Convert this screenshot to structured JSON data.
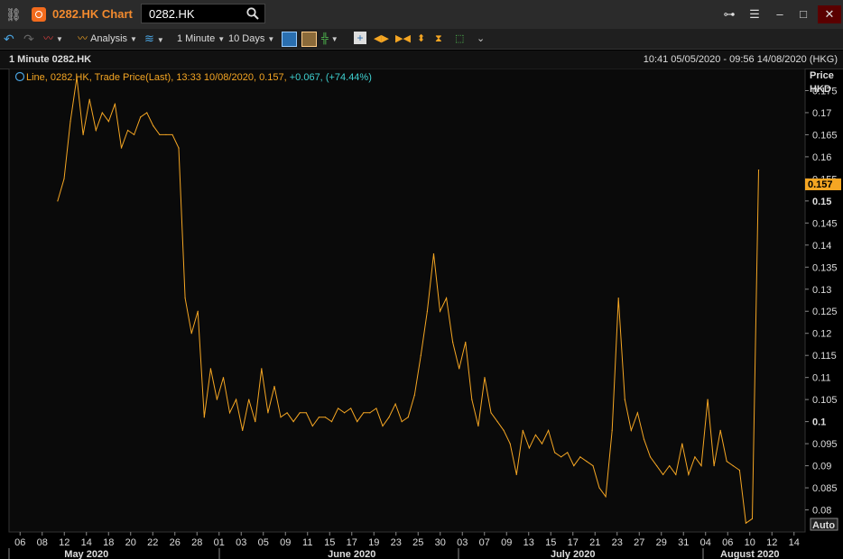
{
  "window": {
    "title": "0282.HK Chart",
    "ticker_value": "0282.HK",
    "colors": {
      "accent": "#f28a2e",
      "series": "#f5a623",
      "positive": "#3fd0d0",
      "current_label_bg": "#f5a623"
    }
  },
  "toolbar": {
    "analysis_label": "Analysis",
    "interval_label": "1 Minute",
    "period_label": "10 Days"
  },
  "chart_header": {
    "name": "1 Minute 0282.HK",
    "range": "10:41 05/05/2020 - 09:56 14/08/2020 (HKG)"
  },
  "legend": {
    "prefix": "Line, 0282.HK, Trade Price(Last),",
    "time": "13:33 10/08/2020,",
    "price": "0.157,",
    "change": "+0.067,",
    "change_pct": "(+74.44%)"
  },
  "axis": {
    "y_title_1": "Price",
    "y_title_2": "HKD",
    "auto_label": "Auto",
    "current_value_label": "0.157"
  },
  "chart_data": {
    "type": "line",
    "title": "1 Minute 0282.HK",
    "series": [
      {
        "name": "Line, 0282.HK, Trade Price(Last)",
        "color": "#f5a623"
      }
    ],
    "ylabel": "Price HKD",
    "ylim": [
      0.075,
      0.18
    ],
    "yticks": [
      "0.175",
      "0.17",
      "0.165",
      "0.16",
      "0.155",
      "0.15",
      "0.145",
      "0.14",
      "0.135",
      "0.13",
      "0.125",
      "0.12",
      "0.115",
      "0.11",
      "0.105",
      "0.1",
      "0.095",
      "0.09",
      "0.085",
      "0.08"
    ],
    "x_tick_labels": [
      "06",
      "08",
      "12",
      "14",
      "18",
      "20",
      "22",
      "26",
      "28",
      "01",
      "03",
      "05",
      "09",
      "11",
      "15",
      "17",
      "19",
      "23",
      "25",
      "30",
      "03",
      "07",
      "09",
      "13",
      "15",
      "17",
      "21",
      "23",
      "27",
      "29",
      "31",
      "04",
      "06",
      "10",
      "12",
      "14"
    ],
    "x_months": [
      "May 2020",
      "June 2020",
      "July 2020",
      "August 2020"
    ],
    "points": [
      [
        "2020-05-11",
        0.15
      ],
      [
        "2020-05-11",
        0.155
      ],
      [
        "2020-05-12",
        0.168
      ],
      [
        "2020-05-12",
        0.178
      ],
      [
        "2020-05-12",
        0.165
      ],
      [
        "2020-05-13",
        0.173
      ],
      [
        "2020-05-13",
        0.166
      ],
      [
        "2020-05-14",
        0.17
      ],
      [
        "2020-05-15",
        0.168
      ],
      [
        "2020-05-15",
        0.172
      ],
      [
        "2020-05-18",
        0.162
      ],
      [
        "2020-05-18",
        0.166
      ],
      [
        "2020-05-19",
        0.165
      ],
      [
        "2020-05-19",
        0.169
      ],
      [
        "2020-05-20",
        0.17
      ],
      [
        "2020-05-20",
        0.167
      ],
      [
        "2020-05-21",
        0.165
      ],
      [
        "2020-05-22",
        0.165
      ],
      [
        "2020-05-26",
        0.165
      ],
      [
        "2020-05-26",
        0.162
      ],
      [
        "2020-05-27",
        0.128
      ],
      [
        "2020-05-27",
        0.12
      ],
      [
        "2020-05-28",
        0.125
      ],
      [
        "2020-05-28",
        0.101
      ],
      [
        "2020-05-29",
        0.112
      ],
      [
        "2020-05-29",
        0.105
      ],
      [
        "2020-06-01",
        0.11
      ],
      [
        "2020-06-01",
        0.102
      ],
      [
        "2020-06-02",
        0.105
      ],
      [
        "2020-06-03",
        0.098
      ],
      [
        "2020-06-04",
        0.105
      ],
      [
        "2020-06-05",
        0.1
      ],
      [
        "2020-06-05",
        0.112
      ],
      [
        "2020-06-08",
        0.102
      ],
      [
        "2020-06-08",
        0.108
      ],
      [
        "2020-06-09",
        0.101
      ],
      [
        "2020-06-10",
        0.102
      ],
      [
        "2020-06-11",
        0.1
      ],
      [
        "2020-06-11",
        0.102
      ],
      [
        "2020-06-12",
        0.102
      ],
      [
        "2020-06-15",
        0.099
      ],
      [
        "2020-06-16",
        0.101
      ],
      [
        "2020-06-17",
        0.101
      ],
      [
        "2020-06-18",
        0.1
      ],
      [
        "2020-06-19",
        0.103
      ],
      [
        "2020-06-22",
        0.102
      ],
      [
        "2020-06-22",
        0.103
      ],
      [
        "2020-06-23",
        0.1
      ],
      [
        "2020-06-24",
        0.102
      ],
      [
        "2020-06-26",
        0.102
      ],
      [
        "2020-06-29",
        0.103
      ],
      [
        "2020-06-29",
        0.099
      ],
      [
        "2020-06-30",
        0.101
      ],
      [
        "2020-07-02",
        0.104
      ],
      [
        "2020-07-03",
        0.1
      ],
      [
        "2020-07-06",
        0.101
      ],
      [
        "2020-07-07",
        0.106
      ],
      [
        "2020-07-08",
        0.115
      ],
      [
        "2020-07-08",
        0.125
      ],
      [
        "2020-07-09",
        0.138
      ],
      [
        "2020-07-09",
        0.125
      ],
      [
        "2020-07-10",
        0.128
      ],
      [
        "2020-07-13",
        0.118
      ],
      [
        "2020-07-14",
        0.112
      ],
      [
        "2020-07-14",
        0.118
      ],
      [
        "2020-07-15",
        0.105
      ],
      [
        "2020-07-15",
        0.099
      ],
      [
        "2020-07-16",
        0.11
      ],
      [
        "2020-07-17",
        0.102
      ],
      [
        "2020-07-17",
        0.1
      ],
      [
        "2020-07-20",
        0.098
      ],
      [
        "2020-07-21",
        0.095
      ],
      [
        "2020-07-22",
        0.088
      ],
      [
        "2020-07-22",
        0.098
      ],
      [
        "2020-07-23",
        0.094
      ],
      [
        "2020-07-24",
        0.097
      ],
      [
        "2020-07-27",
        0.095
      ],
      [
        "2020-07-28",
        0.098
      ],
      [
        "2020-07-29",
        0.093
      ],
      [
        "2020-07-30",
        0.092
      ],
      [
        "2020-07-31",
        0.093
      ],
      [
        "2020-08-03",
        0.09
      ],
      [
        "2020-08-04",
        0.092
      ],
      [
        "2020-08-05",
        0.091
      ],
      [
        "2020-08-06",
        0.09
      ],
      [
        "2020-08-07",
        0.085
      ],
      [
        "2020-08-07",
        0.083
      ],
      [
        "2020-08-10",
        0.098
      ],
      [
        "2020-08-10",
        0.128
      ],
      [
        "2020-08-10",
        0.105
      ],
      [
        "2020-08-11",
        0.098
      ],
      [
        "2020-08-11",
        0.102
      ],
      [
        "2020-08-12",
        0.096
      ],
      [
        "2020-08-12",
        0.092
      ],
      [
        "2020-08-13",
        0.09
      ],
      [
        "2020-08-14",
        0.088
      ],
      [
        "2020-08-14",
        0.09
      ],
      [
        "2020-08-17",
        0.088
      ],
      [
        "2020-08-18",
        0.095
      ],
      [
        "2020-08-19",
        0.088
      ],
      [
        "2020-08-20",
        0.092
      ],
      [
        "2020-08-21",
        0.09
      ],
      [
        "2020-08-24",
        0.105
      ],
      [
        "2020-08-25",
        0.09
      ],
      [
        "2020-08-26",
        0.098
      ],
      [
        "2020-08-27",
        0.091
      ],
      [
        "2020-08-28",
        0.09
      ],
      [
        "2020-08-31",
        0.089
      ],
      [
        "2020-09-01",
        0.077
      ],
      [
        "2020-09-02",
        0.078
      ],
      [
        "2020-09-03",
        0.157
      ]
    ]
  }
}
